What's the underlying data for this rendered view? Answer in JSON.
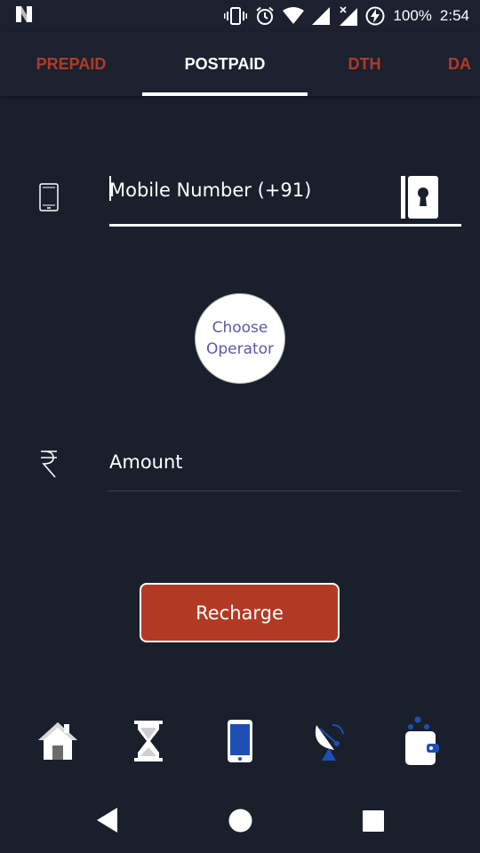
{
  "status_bar": {
    "battery": "100%",
    "time": "2:54"
  },
  "tabs": [
    {
      "label": "PREPAID",
      "active": false
    },
    {
      "label": "POSTPAID",
      "active": true
    },
    {
      "label": "DTH",
      "active": false
    },
    {
      "label": "DA",
      "active": false
    }
  ],
  "form": {
    "mobile_placeholder": "Mobile Number (+91)",
    "mobile_value": "",
    "operator_label": "Choose Operator",
    "amount_placeholder": "Amount",
    "amount_value": "",
    "recharge_label": "Recharge"
  },
  "bottom_nav": [
    {
      "icon": "home-icon"
    },
    {
      "icon": "hourglass-icon"
    },
    {
      "icon": "mobile-phone-icon"
    },
    {
      "icon": "satellite-dish-icon"
    },
    {
      "icon": "wallet-icon"
    }
  ],
  "colors": {
    "background": "#1a1f2c",
    "accent": "#b23a25",
    "operator_text": "#5b58a8",
    "nav_blue": "#1e4fb6"
  }
}
